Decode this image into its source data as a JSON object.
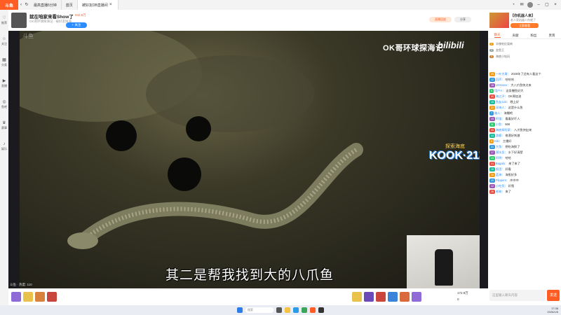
{
  "titlebar": {
    "logo": "斗鱼",
    "tabs": [
      "最高直播5分钟",
      "首页",
      "被好友DB直播间"
    ],
    "active_tab": "被好友DB直播间"
  },
  "leftnav": [
    "推荐",
    "关注",
    "分类",
    "直播",
    "鱼吧",
    "赛事",
    "娱乐"
  ],
  "stream": {
    "title": "就在咱家来看Show了",
    "hot": "942.8万",
    "meta": "OK哥环球探海记 · 被好友探海",
    "follow_label": "+ 关注",
    "pill1": "直播回放",
    "pill2": "分享"
  },
  "video": {
    "corner_label": "斗鱼",
    "watermark": "OK哥环球探海记",
    "bili": "bilibili",
    "kook_top": "探索海底",
    "kook_main": "KOOK·212",
    "subtitle": "其二是帮我找到大的八爪鱼"
  },
  "bottom": {
    "viewer": "斗鱼 · 热度: 110",
    "stat1": "172.8万",
    "stat2": "0"
  },
  "right_panel": {
    "ad_title": "【你机器人来】",
    "ad_sub": "老人家机器人你就了",
    "ad_btn": "立即查看",
    "tabs": [
      "聊天",
      "贡献",
      "粉丝",
      "贵宾"
    ],
    "active_tab": "聊天",
    "rank": [
      {
        "num": "1",
        "name": "半夜吃红烧肉"
      },
      {
        "num": "2",
        "name": "金鱼王"
      },
      {
        "num": "3",
        "name": "海底小钻风"
      }
    ],
    "chat": [
      {
        "badge": "25",
        "color": "#f39c12",
        "user": "一叶大哥：",
        "text": "2026年了还有人看这个"
      },
      {
        "badge": "12",
        "color": "#3498db",
        "user": "回声：",
        "text": "哈哈哈"
      },
      {
        "badge": "18",
        "color": "#9b59b6",
        "user": "LEXxxxx：",
        "text": "大八爪鱼快点来"
      },
      {
        "badge": "9",
        "color": "#2ecc71",
        "user": "用户A：",
        "text": "这条鳗鱼好大"
      },
      {
        "badge": "30",
        "color": "#e74c3c",
        "user": "海之子：",
        "text": "OK哥加油"
      },
      {
        "badge": "15",
        "color": "#1abc9c",
        "user": "鱼友123：",
        "text": "晚上好"
      },
      {
        "badge": "22",
        "color": "#f39c12",
        "user": "深海人：",
        "text": "这是什么鱼"
      },
      {
        "badge": "7",
        "color": "#3498db",
        "user": "路人：",
        "text": "海鳗吧"
      },
      {
        "badge": "19",
        "color": "#9b59b6",
        "user": "阿强：",
        "text": "看着好吓人"
      },
      {
        "badge": "11",
        "color": "#2ecc71",
        "user": "小鱼：",
        "text": "666"
      },
      {
        "badge": "26",
        "color": "#e74c3c",
        "user": "海底探险家：",
        "text": "八爪鱼快出来"
      },
      {
        "badge": "14",
        "color": "#1abc9c",
        "user": "游客：",
        "text": "夜潜好刺激"
      },
      {
        "badge": "8",
        "color": "#f39c12",
        "user": "Kiki：",
        "text": "主播好"
      },
      {
        "badge": "21",
        "color": "#3498db",
        "user": "大鱼：",
        "text": "想吃海鲜了"
      },
      {
        "badge": "17",
        "color": "#9b59b6",
        "user": "潜水员：",
        "text": "水下好清楚"
      },
      {
        "badge": "13",
        "color": "#2ecc71",
        "user": "阿明：",
        "text": "哈哈"
      },
      {
        "badge": "24",
        "color": "#e74c3c",
        "user": "Bugalo：",
        "text": "来了来了"
      },
      {
        "badge": "10",
        "color": "#1abc9c",
        "user": "饭团：",
        "text": "好看"
      },
      {
        "badge": "16",
        "color": "#f39c12",
        "user": "蓝海：",
        "text": "海胆好多"
      },
      {
        "badge": "20",
        "color": "#3498db",
        "user": "Flippers：",
        "text": "冲冲冲"
      },
      {
        "badge": "12",
        "color": "#9b59b6",
        "user": "小吃货：",
        "text": "好饿"
      },
      {
        "badge": "28",
        "color": "#e74c3c",
        "user": "老粉：",
        "text": "来了"
      }
    ],
    "input_placeholder": "这里输入聊天内容",
    "send_label": "发送"
  },
  "taskbar": {
    "search_placeholder": "搜索",
    "time": "17:38",
    "date": "2026/1/6"
  }
}
